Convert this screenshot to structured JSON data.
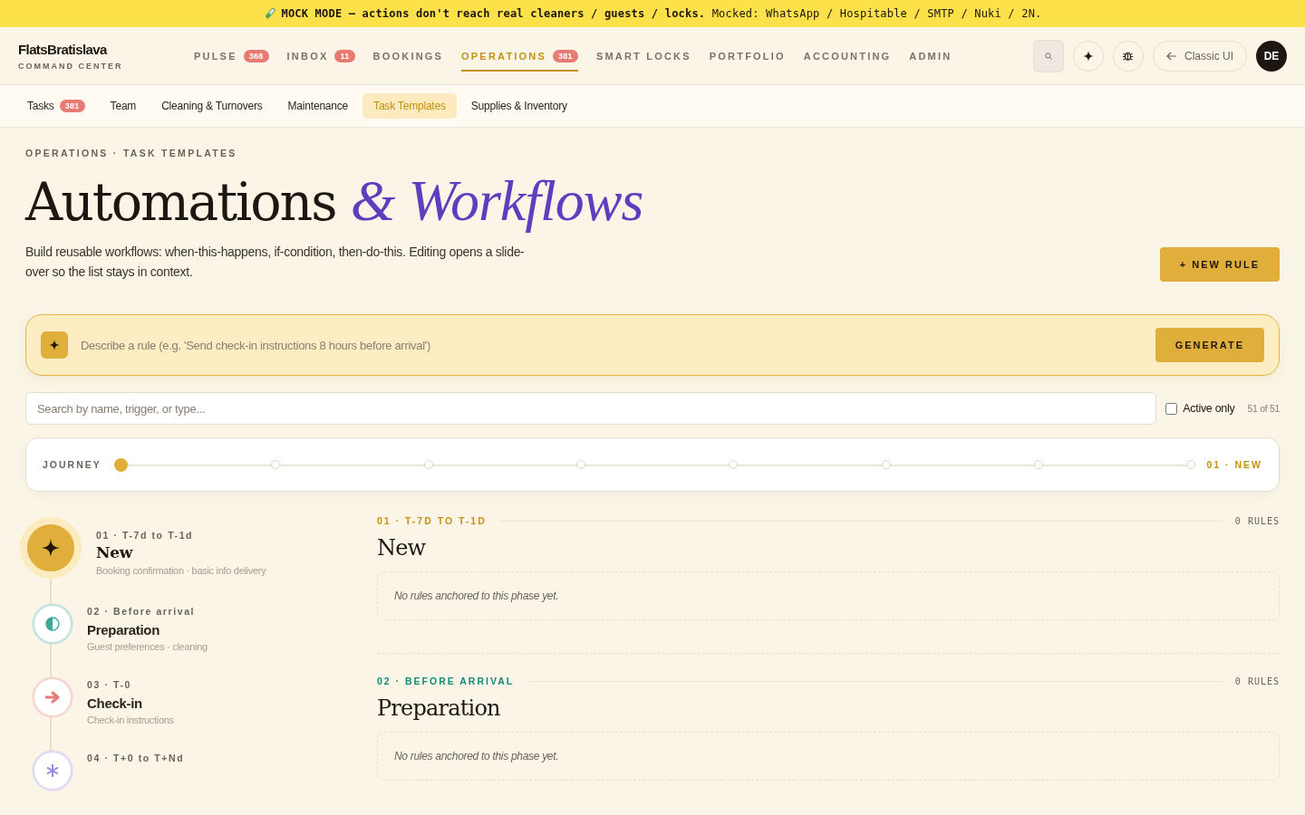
{
  "banner": {
    "text": "**MOCK MODE — actions don't reach real cleaners / guests / locks.** Mocked: WhatsApp / Hospitable / SMTP / Nuki / 2N."
  },
  "brand": {
    "name": "FlatsBratislava",
    "tagline": "COMMAND CENTER"
  },
  "nav": [
    {
      "label": "PULSE",
      "badge": "368",
      "selected": false
    },
    {
      "label": "INBOX",
      "badge": "11",
      "selected": false
    },
    {
      "label": "BOOKINGS",
      "selected": false
    },
    {
      "label": "OPERATIONS",
      "badge": "381",
      "selected": true
    },
    {
      "label": "SMART LOCKS",
      "selected": false
    },
    {
      "label": "PORTFOLIO",
      "selected": false
    },
    {
      "label": "ACCOUNTING",
      "selected": false
    },
    {
      "label": "ADMIN",
      "selected": false
    }
  ],
  "header_actions": {
    "classic_button": "Classic UI",
    "avatar": "DE"
  },
  "subtabs": [
    {
      "label": "Tasks",
      "badge": "381",
      "selected": false
    },
    {
      "label": "Team",
      "selected": false
    },
    {
      "label": "Cleaning & Turnovers",
      "selected": false
    },
    {
      "label": "Maintenance",
      "selected": false
    },
    {
      "label": "Task Templates",
      "selected": true
    },
    {
      "label": "Supplies & Inventory",
      "selected": false
    }
  ],
  "breadcrumb": "OPERATIONS · TASK TEMPLATES",
  "title": {
    "plain": "Automations",
    "accent": "& Workflows"
  },
  "description": "Build reusable workflows: when-this-happens, if-condition, then-do-this. Editing opens a slide-over so the list stays in context.",
  "new_rule_button": "+ NEW RULE",
  "generator": {
    "placeholder": "Describe a rule (e.g. 'Send check-in instructions 8 hours before arrival')",
    "button": "GENERATE"
  },
  "search": {
    "placeholder": "Search by name, trigger, or type...",
    "active_only": {
      "label": "Active only",
      "checked": false
    },
    "count": "51 of 51"
  },
  "journey": {
    "label": "JOURNEY",
    "current": "01 · NEW",
    "steps": [
      {
        "selected": true
      },
      {
        "selected": false
      },
      {
        "selected": false
      },
      {
        "selected": false
      },
      {
        "selected": false
      },
      {
        "selected": false
      },
      {
        "selected": false
      },
      {
        "selected": false
      }
    ]
  },
  "phases": [
    {
      "kind": "sparkle",
      "color": "#e0ae3a",
      "selected": true,
      "label": "01 · T-7d to T-1d",
      "title": "New",
      "subtitle": "Booking confirmation · basic info delivery"
    },
    {
      "kind": "half",
      "color": "#3aa99a",
      "selected": false,
      "label": "02 · Before arrival",
      "title": "Preparation",
      "subtitle": "Guest preferences · cleaning"
    },
    {
      "kind": "arrow",
      "color": "#e77a72",
      "selected": false,
      "label": "03 · T-0",
      "title": "Check-in",
      "subtitle": "Check-in instructions"
    },
    {
      "kind": "asterisk",
      "color": "#9b86e0",
      "selected": false,
      "label": "04 · T+0 to T+Nd"
    }
  ],
  "sections": [
    {
      "label": "01 · T-7D TO T-1D",
      "color": "#c4920e",
      "count": "0 RULES",
      "title": "New",
      "empty": "No rules anchored to this phase yet."
    },
    {
      "label": "02 · BEFORE ARRIVAL",
      "color": "#138a75",
      "count": "0 RULES",
      "title": "Preparation",
      "empty": "No rules anchored to this phase yet."
    }
  ]
}
